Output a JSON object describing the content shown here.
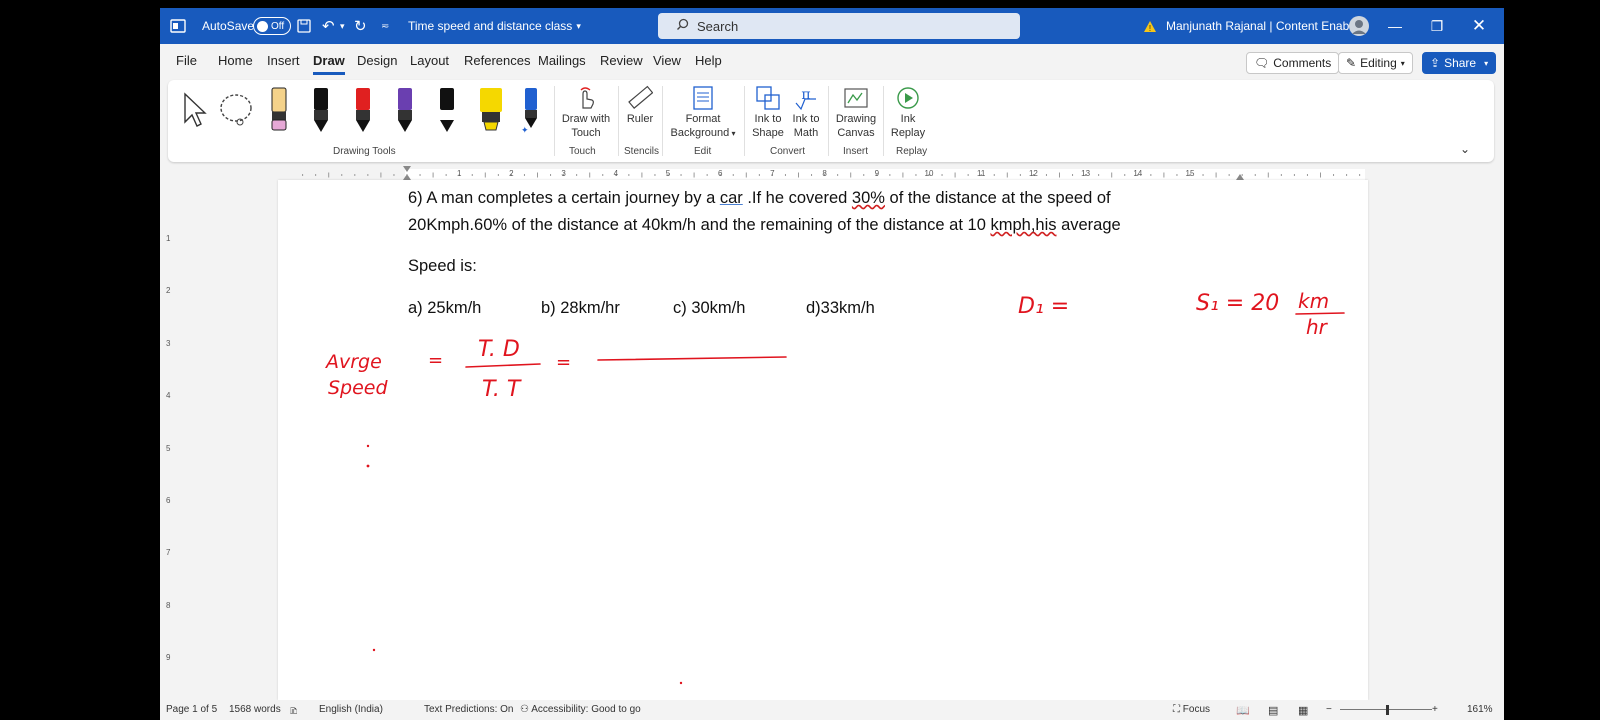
{
  "titlebar": {
    "autosave_label": "AutoSave",
    "autosave_state": "Off",
    "doc_title": "Time speed and distance class",
    "search_placeholder": "Search",
    "user": "Manjunath Rajanal | Content Enablers"
  },
  "menu": {
    "tabs": [
      "File",
      "Home",
      "Insert",
      "Draw",
      "Design",
      "Layout",
      "References",
      "Mailings",
      "Review",
      "View",
      "Help"
    ],
    "active_tab": "Draw",
    "comments_label": "Comments",
    "editing_label": "Editing",
    "share_label": "Share"
  },
  "ribbon": {
    "commands": {
      "draw_with_touch": [
        "Draw with",
        "Touch"
      ],
      "ruler": [
        "Ruler"
      ],
      "format_background": [
        "Format",
        "Background"
      ],
      "ink_to_shape": [
        "Ink to",
        "Shape"
      ],
      "ink_to_math": [
        "Ink to",
        "Math"
      ],
      "drawing_canvas": [
        "Drawing",
        "Canvas"
      ],
      "ink_replay": [
        "Ink",
        "Replay"
      ]
    },
    "groups": {
      "drawing_tools": "Drawing Tools",
      "touch": "Touch",
      "stencils": "Stencils",
      "edit": "Edit",
      "convert": "Convert",
      "insert": "Insert",
      "replay": "Replay"
    },
    "pen_colors": [
      "#f4d28a",
      "#111111",
      "#e02020",
      "#6a3fb0",
      "#111111",
      "#f5d800",
      "#2060d0"
    ]
  },
  "ruler": {
    "h_numbers": [
      "1",
      "2",
      "3",
      "4",
      "5",
      "6",
      "7",
      "8",
      "9",
      "10",
      "11",
      "12",
      "13",
      "14",
      "15"
    ],
    "v_numbers": [
      "1",
      "2",
      "3",
      "4",
      "5",
      "6",
      "7",
      "8",
      "9"
    ]
  },
  "document": {
    "q_prefix": "6) A man completes a certain journey by a ",
    "q_car": "car",
    "q_mid1": " .If he covered ",
    "q_30": "30%",
    "q_mid2": " of the distance at the speed of",
    "line2_a": "20Kmph.60% of the distance at 40km/h and the remaining of the distance at 10 ",
    "line2_kmph": "kmph,his",
    "line2_b": " average",
    "line3": "Speed is:",
    "options": [
      "a) 25km/h",
      "b) 28km/hr",
      "c) 30km/h",
      "d)33km/h"
    ]
  },
  "ink_notes": {
    "avg": "Avrge",
    "speed": "Speed",
    "eq": "=",
    "td": "T. D",
    "tt": "T. T",
    "d1": "D₁ =",
    "s1": "S₁ = 20",
    "km": "km",
    "hr": "hr",
    "color": "#e0141e"
  },
  "statusbar": {
    "page": "Page 1 of 5",
    "words": "1568 words",
    "language": "English (India)",
    "predictions": "Text Predictions: On",
    "accessibility": "Accessibility: Good to go",
    "focus": "Focus",
    "zoom": "161%"
  },
  "colors": {
    "accent": "#185abd",
    "ink": "#e0141e"
  }
}
